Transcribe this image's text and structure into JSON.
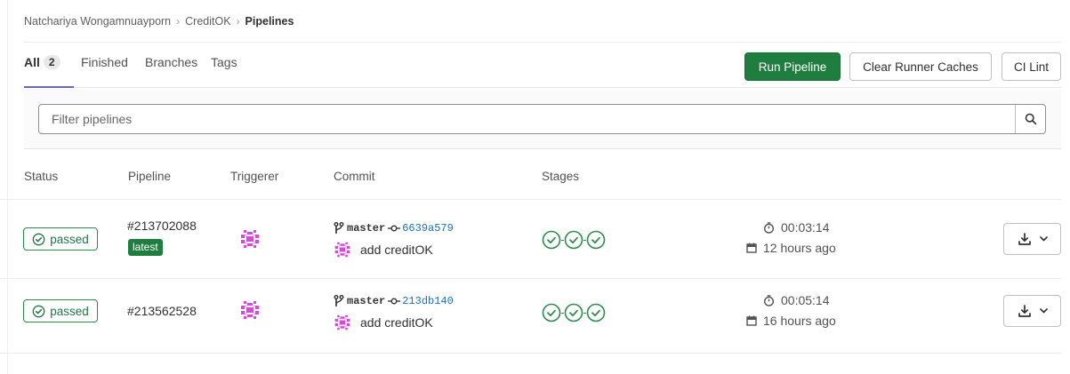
{
  "breadcrumb": {
    "items": [
      "Natchariya Wongamnuayporn",
      "CreditOK"
    ],
    "current": "Pipelines"
  },
  "tabs": [
    {
      "label": "All",
      "count": "2",
      "active": true
    },
    {
      "label": "Finished"
    },
    {
      "label": "Branches"
    },
    {
      "label": "Tags"
    }
  ],
  "actions": {
    "run_pipeline": "Run Pipeline",
    "clear_caches": "Clear Runner Caches",
    "ci_lint": "CI Lint"
  },
  "filter": {
    "placeholder": "Filter pipelines"
  },
  "table": {
    "headers": {
      "status": "Status",
      "pipeline": "Pipeline",
      "triggerer": "Triggerer",
      "commit": "Commit",
      "stages": "Stages"
    },
    "rows": [
      {
        "status": "passed",
        "pipeline_id": "#213702088",
        "latest_label": "latest",
        "branch": "master",
        "sha": "6639a579",
        "message": "add creditOK",
        "duration": "00:03:14",
        "finished": "12 hours ago"
      },
      {
        "status": "passed",
        "pipeline_id": "#213562528",
        "branch": "master",
        "sha": "213db140",
        "message": "add creditOK",
        "duration": "00:05:14",
        "finished": "16 hours ago"
      }
    ]
  },
  "colors": {
    "success": "#1f7e3f",
    "tab_indicator": "#6666c4",
    "link": "#1f6fb5",
    "avatar": "#d64ad8"
  },
  "icons": [
    "chevron-right-icon",
    "search-icon",
    "check-circle-icon",
    "branch-icon",
    "commit-icon",
    "timer-icon",
    "calendar-icon",
    "download-icon",
    "chevron-down-icon",
    "identicon-avatar"
  ]
}
